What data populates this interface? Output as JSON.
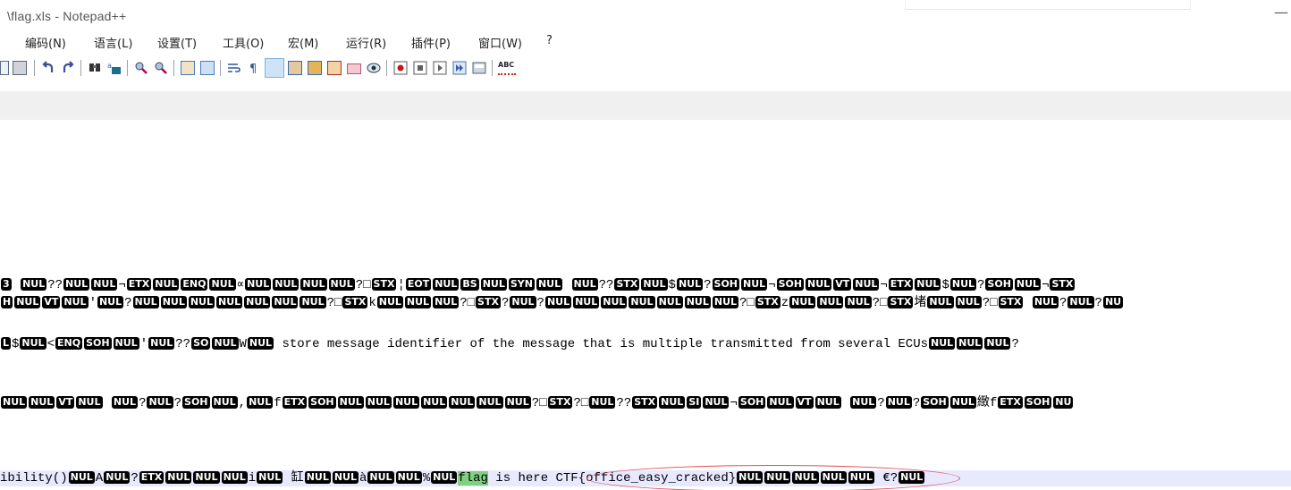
{
  "window": {
    "title": "\\flag.xls - Notepad++",
    "minimize_glyph": "—"
  },
  "menu": [
    "编码(N)",
    "语言(L)",
    "设置(T)",
    "工具(O)",
    "宏(M)",
    "运行(R)",
    "插件(P)",
    "窗口(W)",
    "?"
  ],
  "toolbar_icons": [
    "new-file-icon",
    "open-file-icon",
    "undo-icon",
    "redo-icon",
    "find-icon",
    "replace-icon",
    "zoom-in-icon",
    "zoom-out-icon",
    "sync-vertical-icon",
    "sync-horizontal-icon",
    "word-wrap-icon",
    "show-all-chars-icon",
    "indent-guide-icon",
    "document-map-icon",
    "function-list-icon",
    "folder-workspace-icon",
    "folder-icon",
    "monitoring-icon",
    "record-macro-icon",
    "stop-record-icon",
    "play-macro-icon",
    "run-macro-multiple-icon",
    "save-macro-icon",
    "spellcheck-icon"
  ],
  "spellcheck_label": "ABC",
  "editor": {
    "lines": [
      [
        [
          "c",
          "3"
        ],
        [
          "t",
          "  "
        ],
        [
          "c",
          "NUL"
        ],
        [
          "t",
          "??"
        ],
        [
          "c",
          "NUL"
        ],
        [
          "c",
          "NUL"
        ],
        [
          "t",
          "¬"
        ],
        [
          "c",
          "ETX"
        ],
        [
          "c",
          "NUL"
        ],
        [
          "c",
          "ENQ"
        ],
        [
          "c",
          "NUL"
        ],
        [
          "t",
          "∝"
        ],
        [
          "c",
          "NUL"
        ],
        [
          "c",
          "NUL"
        ],
        [
          "c",
          "NUL"
        ],
        [
          "c",
          "NUL"
        ],
        [
          "t",
          "?□"
        ],
        [
          "c",
          "STX"
        ],
        [
          "t",
          "¦"
        ],
        [
          "c",
          "EOT"
        ],
        [
          "c",
          "NUL"
        ],
        [
          "c",
          "BS"
        ],
        [
          "c",
          "NUL"
        ],
        [
          "c",
          "SYN"
        ],
        [
          "c",
          "NUL"
        ],
        [
          "t",
          "  "
        ],
        [
          "c",
          "NUL"
        ],
        [
          "t",
          "??"
        ],
        [
          "c",
          "STX"
        ],
        [
          "c",
          "NUL"
        ],
        [
          "t",
          "$"
        ],
        [
          "c",
          "NUL"
        ],
        [
          "t",
          "?"
        ],
        [
          "c",
          "SOH"
        ],
        [
          "c",
          "NUL"
        ],
        [
          "t",
          "¬"
        ],
        [
          "c",
          "SOH"
        ],
        [
          "c",
          "NUL"
        ],
        [
          "c",
          "VT"
        ],
        [
          "c",
          "NUL"
        ],
        [
          "t",
          "¬"
        ],
        [
          "c",
          "ETX"
        ],
        [
          "c",
          "NUL"
        ],
        [
          "t",
          "$"
        ],
        [
          "c",
          "NUL"
        ],
        [
          "t",
          "?"
        ],
        [
          "c",
          "SOH"
        ],
        [
          "c",
          "NUL"
        ],
        [
          "t",
          "¬"
        ],
        [
          "c",
          "STX"
        ]
      ],
      [
        [
          "c",
          "H"
        ],
        [
          "c",
          "NUL"
        ],
        [
          "c",
          "VT"
        ],
        [
          "c",
          "NUL"
        ],
        [
          "t",
          "'"
        ],
        [
          "c",
          "NUL"
        ],
        [
          "t",
          "?"
        ],
        [
          "c",
          "NUL"
        ],
        [
          "c",
          "NUL"
        ],
        [
          "c",
          "NUL"
        ],
        [
          "c",
          "NUL"
        ],
        [
          "c",
          "NUL"
        ],
        [
          "c",
          "NUL"
        ],
        [
          "c",
          "NUL"
        ],
        [
          "t",
          "?□"
        ],
        [
          "c",
          "STX"
        ],
        [
          "t",
          "k"
        ],
        [
          "c",
          "NUL"
        ],
        [
          "c",
          "NUL"
        ],
        [
          "c",
          "NUL"
        ],
        [
          "t",
          "?□"
        ],
        [
          "c",
          "STX"
        ],
        [
          "t",
          "?"
        ],
        [
          "c",
          "NUL"
        ],
        [
          "t",
          "?"
        ],
        [
          "c",
          "NUL"
        ],
        [
          "c",
          "NUL"
        ],
        [
          "c",
          "NUL"
        ],
        [
          "c",
          "NUL"
        ],
        [
          "c",
          "NUL"
        ],
        [
          "c",
          "NUL"
        ],
        [
          "c",
          "NUL"
        ],
        [
          "t",
          "?□"
        ],
        [
          "c",
          "STX"
        ],
        [
          "t",
          "z"
        ],
        [
          "c",
          "NUL"
        ],
        [
          "c",
          "NUL"
        ],
        [
          "c",
          "NUL"
        ],
        [
          "t",
          "?□"
        ],
        [
          "c",
          "STX"
        ],
        [
          "t",
          "堵"
        ],
        [
          "c",
          "NUL"
        ],
        [
          "c",
          "NUL"
        ],
        [
          "t",
          "?□"
        ],
        [
          "c",
          "STX"
        ],
        [
          "t",
          "  "
        ],
        [
          "c",
          "NUL"
        ],
        [
          "t",
          "?"
        ],
        [
          "c",
          "NUL"
        ],
        [
          "t",
          "?"
        ],
        [
          "c",
          "NU"
        ]
      ],
      [
        [
          "c",
          "L"
        ],
        [
          "t",
          "$"
        ],
        [
          "c",
          "NUL"
        ],
        [
          "t",
          "<"
        ],
        [
          "c",
          "ENQ"
        ],
        [
          "c",
          "SOH"
        ],
        [
          "c",
          "NUL"
        ],
        [
          "t",
          "'"
        ],
        [
          "c",
          "NUL"
        ],
        [
          "t",
          "??"
        ],
        [
          "c",
          "SO"
        ],
        [
          "c",
          "NUL"
        ],
        [
          "t",
          "W"
        ],
        [
          "c",
          "NUL"
        ],
        [
          "t",
          " store message identifier of the message that is multiple transmitted from several ECUs"
        ],
        [
          "c",
          "NUL"
        ],
        [
          "c",
          "NUL"
        ],
        [
          "c",
          "NUL"
        ],
        [
          "t",
          "?"
        ]
      ],
      [
        [
          "c",
          "NUL"
        ],
        [
          "c",
          "NUL"
        ],
        [
          "c",
          "VT"
        ],
        [
          "c",
          "NUL"
        ],
        [
          "t",
          "  "
        ],
        [
          "c",
          "NUL"
        ],
        [
          "t",
          "?"
        ],
        [
          "c",
          "NUL"
        ],
        [
          "t",
          "?"
        ],
        [
          "c",
          "SOH"
        ],
        [
          "c",
          "NUL"
        ],
        [
          "t",
          ","
        ],
        [
          "c",
          "NUL"
        ],
        [
          "t",
          "f"
        ],
        [
          "c",
          "ETX"
        ],
        [
          "c",
          "SOH"
        ],
        [
          "c",
          "NUL"
        ],
        [
          "c",
          "NUL"
        ],
        [
          "c",
          "NUL"
        ],
        [
          "c",
          "NUL"
        ],
        [
          "c",
          "NUL"
        ],
        [
          "c",
          "NUL"
        ],
        [
          "c",
          "NUL"
        ],
        [
          "t",
          "?□"
        ],
        [
          "c",
          "STX"
        ],
        [
          "t",
          "?□"
        ],
        [
          "c",
          "NUL"
        ],
        [
          "t",
          "??"
        ],
        [
          "c",
          "STX"
        ],
        [
          "c",
          "NUL"
        ],
        [
          "c",
          "SI"
        ],
        [
          "c",
          "NUL"
        ],
        [
          "t",
          "¬"
        ],
        [
          "c",
          "SOH"
        ],
        [
          "c",
          "NUL"
        ],
        [
          "c",
          "VT"
        ],
        [
          "c",
          "NUL"
        ],
        [
          "t",
          "  "
        ],
        [
          "c",
          "NUL"
        ],
        [
          "t",
          "?"
        ],
        [
          "c",
          "NUL"
        ],
        [
          "t",
          "?"
        ],
        [
          "c",
          "SOH"
        ],
        [
          "c",
          "NUL"
        ],
        [
          "t",
          "緻f"
        ],
        [
          "c",
          "ETX"
        ],
        [
          "c",
          "SOH"
        ],
        [
          "c",
          "NU"
        ]
      ],
      [
        [
          "t",
          "ibility()"
        ],
        [
          "c",
          "NUL"
        ],
        [
          "t",
          "A"
        ],
        [
          "c",
          "NUL"
        ],
        [
          "t",
          "?"
        ],
        [
          "c",
          "ETX"
        ],
        [
          "c",
          "NUL"
        ],
        [
          "c",
          "NUL"
        ],
        [
          "c",
          "NUL"
        ],
        [
          "t",
          "i"
        ],
        [
          "c",
          "NUL"
        ],
        [
          "t",
          "     缸"
        ],
        [
          "c",
          "NUL"
        ],
        [
          "c",
          "NUL"
        ],
        [
          "t",
          "à"
        ],
        [
          "c",
          "NUL"
        ],
        [
          "c",
          "NUL"
        ],
        [
          "t",
          "%"
        ],
        [
          "c",
          "NUL"
        ],
        [
          "h",
          "flag"
        ],
        [
          "t",
          " is here CTF{office_easy_cracked}"
        ],
        [
          "c",
          "NUL"
        ],
        [
          "c",
          "NUL"
        ],
        [
          "c",
          "NUL"
        ],
        [
          "c",
          "NUL"
        ],
        [
          "c",
          "NUL"
        ],
        [
          "t",
          "          €?"
        ],
        [
          "c",
          "NUL"
        ]
      ]
    ]
  },
  "colors": {
    "control_bg": "#000000",
    "control_fg": "#ffffff",
    "highlight": "#7fd07f",
    "current_line": "#e8e8ff",
    "annotation": "#e05050"
  }
}
